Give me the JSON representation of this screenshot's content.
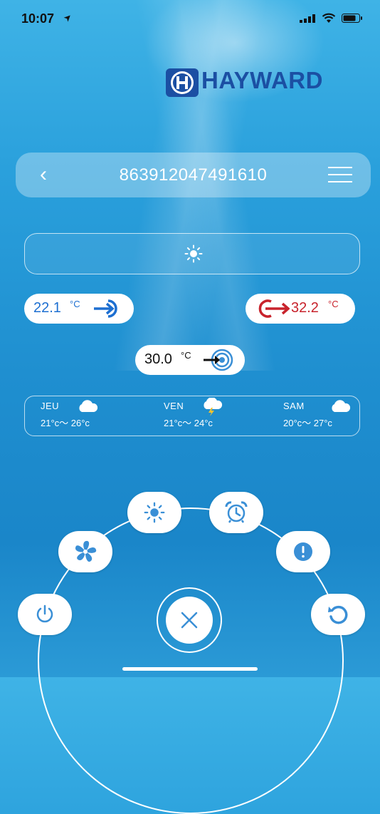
{
  "status_bar": {
    "time": "10:07",
    "location_arrow": "➤"
  },
  "brand": {
    "name": "HAYWARD",
    "registered": "®",
    "color": "#1b4fa3"
  },
  "header": {
    "back_label": "‹",
    "device_id": "863912047491610"
  },
  "mode": {
    "icon": "sun-icon"
  },
  "temperatures": {
    "inlet": {
      "value": "22.1",
      "unit": "°C"
    },
    "outlet": {
      "value": "32.2",
      "unit": "°C"
    },
    "setpoint": {
      "value": "30.0",
      "unit": "°C"
    }
  },
  "forecast": [
    {
      "day": "JEU",
      "range": "21°c～ 26°c",
      "icon": "cloud-icon"
    },
    {
      "day": "VEN",
      "range": "21°c～ 24°c",
      "icon": "storm-icon"
    },
    {
      "day": "SAM",
      "range": "20°c～ 27°c",
      "icon": "cloud-icon"
    }
  ],
  "controls": {
    "power": "power-icon",
    "fan": "fan-icon",
    "heating_mode": "sun-icon",
    "timer": "alarm-clock-icon",
    "alarm": "alert-icon",
    "refresh": "refresh-icon",
    "close": "close-icon"
  },
  "colors": {
    "cold": "#1d6fd1",
    "hot": "#c8232c",
    "accent": "#3a8fd6"
  }
}
